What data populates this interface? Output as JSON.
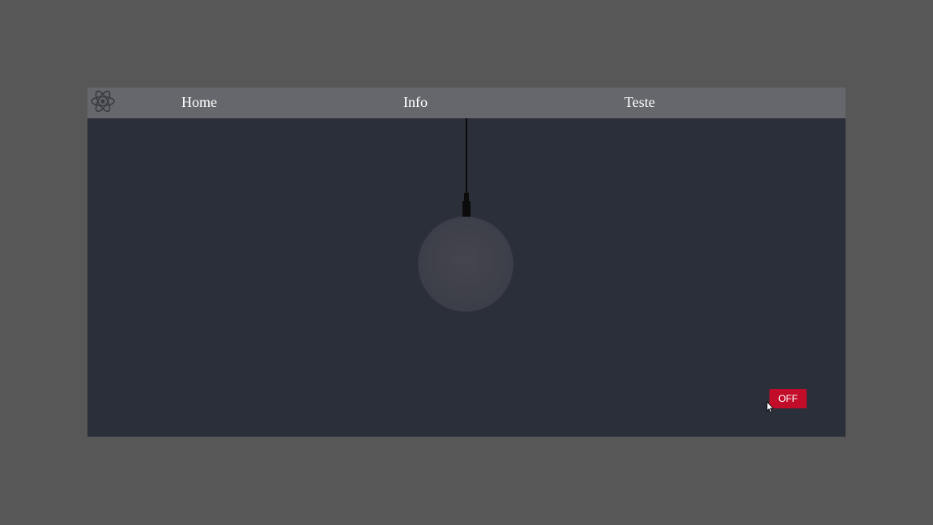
{
  "navbar": {
    "logo_icon": "atom-icon",
    "links": [
      {
        "label": "Home"
      },
      {
        "label": "Info"
      },
      {
        "label": "Teste"
      }
    ]
  },
  "lamp": {
    "state": "off"
  },
  "toggle": {
    "label": "OFF",
    "color": "#c20d2a"
  },
  "colors": {
    "page_background": "#575757",
    "app_background": "#2b2f3a",
    "navbar_background": "#66676d",
    "bulb_off": "#3c3e48"
  }
}
